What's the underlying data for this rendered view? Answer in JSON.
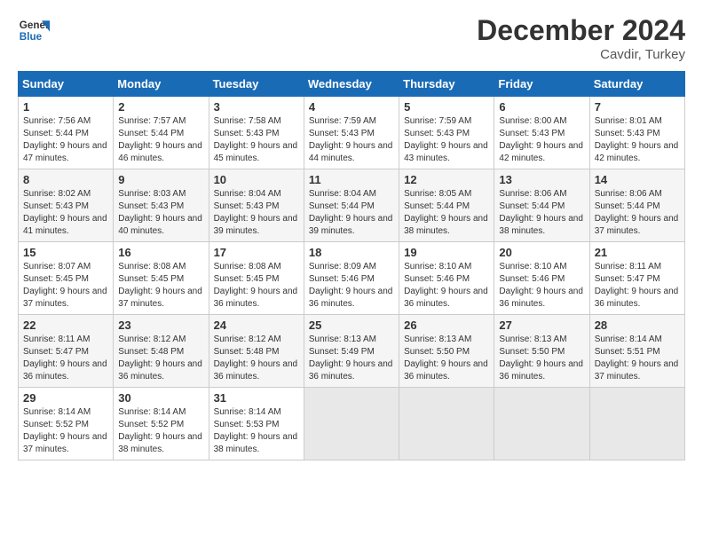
{
  "logo": {
    "line1": "General",
    "line2": "Blue"
  },
  "title": "December 2024",
  "subtitle": "Cavdir, Turkey",
  "days_of_week": [
    "Sunday",
    "Monday",
    "Tuesday",
    "Wednesday",
    "Thursday",
    "Friday",
    "Saturday"
  ],
  "weeks": [
    [
      {
        "num": "1",
        "sunrise": "7:56 AM",
        "sunset": "5:44 PM",
        "daylight": "9 hours and 47 minutes."
      },
      {
        "num": "2",
        "sunrise": "7:57 AM",
        "sunset": "5:44 PM",
        "daylight": "9 hours and 46 minutes."
      },
      {
        "num": "3",
        "sunrise": "7:58 AM",
        "sunset": "5:43 PM",
        "daylight": "9 hours and 45 minutes."
      },
      {
        "num": "4",
        "sunrise": "7:59 AM",
        "sunset": "5:43 PM",
        "daylight": "9 hours and 44 minutes."
      },
      {
        "num": "5",
        "sunrise": "7:59 AM",
        "sunset": "5:43 PM",
        "daylight": "9 hours and 43 minutes."
      },
      {
        "num": "6",
        "sunrise": "8:00 AM",
        "sunset": "5:43 PM",
        "daylight": "9 hours and 42 minutes."
      },
      {
        "num": "7",
        "sunrise": "8:01 AM",
        "sunset": "5:43 PM",
        "daylight": "9 hours and 42 minutes."
      }
    ],
    [
      {
        "num": "8",
        "sunrise": "8:02 AM",
        "sunset": "5:43 PM",
        "daylight": "9 hours and 41 minutes."
      },
      {
        "num": "9",
        "sunrise": "8:03 AM",
        "sunset": "5:43 PM",
        "daylight": "9 hours and 40 minutes."
      },
      {
        "num": "10",
        "sunrise": "8:04 AM",
        "sunset": "5:43 PM",
        "daylight": "9 hours and 39 minutes."
      },
      {
        "num": "11",
        "sunrise": "8:04 AM",
        "sunset": "5:44 PM",
        "daylight": "9 hours and 39 minutes."
      },
      {
        "num": "12",
        "sunrise": "8:05 AM",
        "sunset": "5:44 PM",
        "daylight": "9 hours and 38 minutes."
      },
      {
        "num": "13",
        "sunrise": "8:06 AM",
        "sunset": "5:44 PM",
        "daylight": "9 hours and 38 minutes."
      },
      {
        "num": "14",
        "sunrise": "8:06 AM",
        "sunset": "5:44 PM",
        "daylight": "9 hours and 37 minutes."
      }
    ],
    [
      {
        "num": "15",
        "sunrise": "8:07 AM",
        "sunset": "5:45 PM",
        "daylight": "9 hours and 37 minutes."
      },
      {
        "num": "16",
        "sunrise": "8:08 AM",
        "sunset": "5:45 PM",
        "daylight": "9 hours and 37 minutes."
      },
      {
        "num": "17",
        "sunrise": "8:08 AM",
        "sunset": "5:45 PM",
        "daylight": "9 hours and 36 minutes."
      },
      {
        "num": "18",
        "sunrise": "8:09 AM",
        "sunset": "5:46 PM",
        "daylight": "9 hours and 36 minutes."
      },
      {
        "num": "19",
        "sunrise": "8:10 AM",
        "sunset": "5:46 PM",
        "daylight": "9 hours and 36 minutes."
      },
      {
        "num": "20",
        "sunrise": "8:10 AM",
        "sunset": "5:46 PM",
        "daylight": "9 hours and 36 minutes."
      },
      {
        "num": "21",
        "sunrise": "8:11 AM",
        "sunset": "5:47 PM",
        "daylight": "9 hours and 36 minutes."
      }
    ],
    [
      {
        "num": "22",
        "sunrise": "8:11 AM",
        "sunset": "5:47 PM",
        "daylight": "9 hours and 36 minutes."
      },
      {
        "num": "23",
        "sunrise": "8:12 AM",
        "sunset": "5:48 PM",
        "daylight": "9 hours and 36 minutes."
      },
      {
        "num": "24",
        "sunrise": "8:12 AM",
        "sunset": "5:48 PM",
        "daylight": "9 hours and 36 minutes."
      },
      {
        "num": "25",
        "sunrise": "8:13 AM",
        "sunset": "5:49 PM",
        "daylight": "9 hours and 36 minutes."
      },
      {
        "num": "26",
        "sunrise": "8:13 AM",
        "sunset": "5:50 PM",
        "daylight": "9 hours and 36 minutes."
      },
      {
        "num": "27",
        "sunrise": "8:13 AM",
        "sunset": "5:50 PM",
        "daylight": "9 hours and 36 minutes."
      },
      {
        "num": "28",
        "sunrise": "8:14 AM",
        "sunset": "5:51 PM",
        "daylight": "9 hours and 37 minutes."
      }
    ],
    [
      {
        "num": "29",
        "sunrise": "8:14 AM",
        "sunset": "5:52 PM",
        "daylight": "9 hours and 37 minutes."
      },
      {
        "num": "30",
        "sunrise": "8:14 AM",
        "sunset": "5:52 PM",
        "daylight": "9 hours and 38 minutes."
      },
      {
        "num": "31",
        "sunrise": "8:14 AM",
        "sunset": "5:53 PM",
        "daylight": "9 hours and 38 minutes."
      },
      null,
      null,
      null,
      null
    ]
  ]
}
